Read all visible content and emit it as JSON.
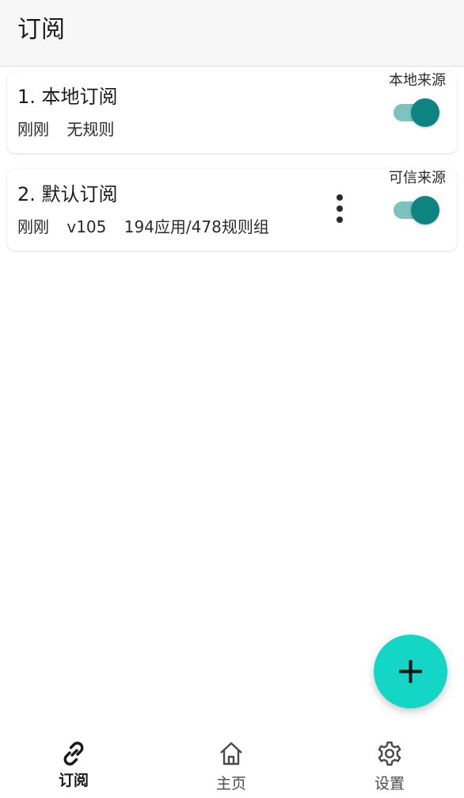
{
  "app_bar": {
    "title": "订阅"
  },
  "subscriptions": [
    {
      "name": "1. 本地订阅",
      "meta": [
        "刚刚",
        "无规则"
      ],
      "source_tag": "本地来源",
      "enabled": true
    },
    {
      "name": "2. 默认订阅",
      "meta": [
        "刚刚",
        "v105",
        "194应用/478规则组"
      ],
      "source_tag": "可信来源",
      "enabled": true
    }
  ],
  "fab": {
    "icon": "plus-icon"
  },
  "bottom_nav": [
    {
      "label": "订阅",
      "icon": "link-icon",
      "active": true
    },
    {
      "label": "主页",
      "icon": "home-icon",
      "active": false
    },
    {
      "label": "设置",
      "icon": "gear-icon",
      "active": false
    }
  ],
  "colors": {
    "accent": "#0d8481",
    "accent_track": "#7cc2bf",
    "fab": "#14d6c6",
    "app_bar_bg": "#f7f7f7"
  }
}
